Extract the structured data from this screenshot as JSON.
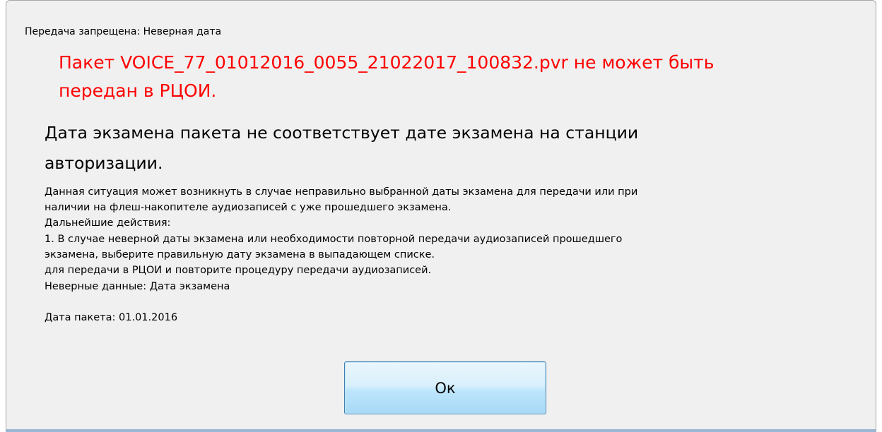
{
  "window": {
    "title": "Передача запрещена: Неверная дата"
  },
  "error": {
    "line1": "Пакет VOICE_77_01012016_0055_21022017_100832.pvr не может быть",
    "line2": "передан в РЦОИ."
  },
  "heading": {
    "line1": "Дата экзамена пакета не соответствует дате экзамена на станции",
    "line2": "авторизации."
  },
  "body": {
    "line1": "Данная ситуация может возникнуть в случае неправильно выбранной даты экзамена для передачи или при",
    "line2": "наличии на флеш-накопителе аудиозаписей с уже прошедшего экзамена.",
    "line3": "Дальнейшие действия:",
    "line4": "1. В случае неверной даты экзамена или необходимости повторной передачи аудиозаписей прошедшего",
    "line5": "экзамена, выберите правильную дату экзамена в выпадающем списке.",
    "line6": "для передачи в РЦОИ и повторите процедуру передачи аудиозаписей.",
    "invalid_data": "Неверные данные: Дата экзамена",
    "package_date": "Дата пакета: 01.01.2016"
  },
  "buttons": {
    "ok_label": "Ок"
  },
  "colors": {
    "error_text": "#ff0000",
    "dialog_background": "#f0f0f0",
    "button_border": "#3c7fb1"
  }
}
